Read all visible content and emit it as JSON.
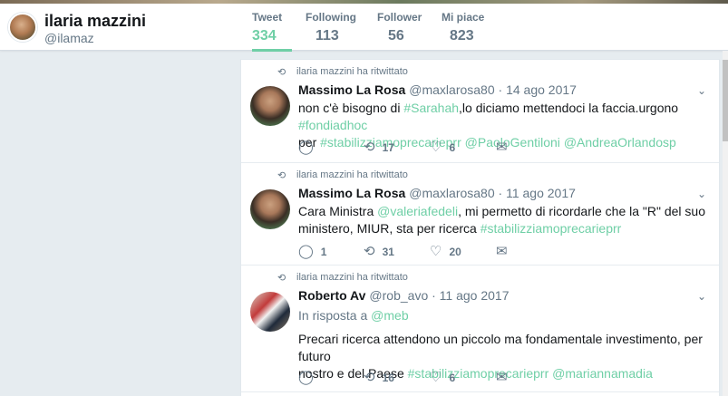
{
  "profile": {
    "name": "ilaria mazzini",
    "handle": "@ilamaz"
  },
  "stats": [
    {
      "label": "Tweet",
      "value": "334",
      "active": true
    },
    {
      "label": "Following",
      "value": "113",
      "active": false
    },
    {
      "label": "Follower",
      "value": "56",
      "active": false
    },
    {
      "label": "Mi piace",
      "value": "823",
      "active": false
    }
  ],
  "colors": {
    "accent": "#6fcfa6",
    "muted": "#657786",
    "text": "#14171a"
  },
  "tweets": [
    {
      "retweet_label": "ilaria mazzini ha ritwittato",
      "name": "Massimo La Rosa",
      "meta": "@maxlarosa80 · 14 ago 2017",
      "text_parts": [
        "non c'è bisogno di ",
        "#Sarahah",
        ",lo diciamo mettendoci la faccia.urgono ",
        "#fondiadhoc",
        "per ",
        "#stabilizziamoprecarieprr",
        " ",
        "@PaoloGentiloni",
        " ",
        "@AndreaOrlandosp"
      ],
      "replies": "",
      "retweets": "17",
      "likes": "6"
    },
    {
      "retweet_label": "ilaria mazzini ha ritwittato",
      "name": "Massimo La Rosa",
      "meta": "@maxlarosa80 · 11 ago 2017",
      "text_parts": [
        "Cara Ministra ",
        "@valeriafedeli",
        ", mi permetto di ricordarle che la \"R\" del suo",
        "ministero, MIUR, sta per ricerca ",
        "#stabilizziamoprecarieprr"
      ],
      "replies": "1",
      "retweets": "31",
      "likes": "20"
    },
    {
      "retweet_label": "ilaria mazzini ha ritwittato",
      "name": "Roberto Av",
      "meta": "@rob_avo · 11 ago 2017",
      "reply_prefix": "In risposta a ",
      "reply_to": "@meb",
      "text_parts": [
        "Precari ricerca attendono un piccolo ma fondamentale investimento, per futuro",
        "nostro e del Paese ",
        "#stabilizziamoprecarieprr",
        " ",
        "@mariannamadia"
      ],
      "replies": "",
      "retweets": "16",
      "likes": "6"
    }
  ],
  "icons": {
    "retweet": "retweet-icon",
    "reply": "reply-icon",
    "like": "heart-icon",
    "dm": "envelope-icon",
    "menu": "chevron-down-icon"
  }
}
